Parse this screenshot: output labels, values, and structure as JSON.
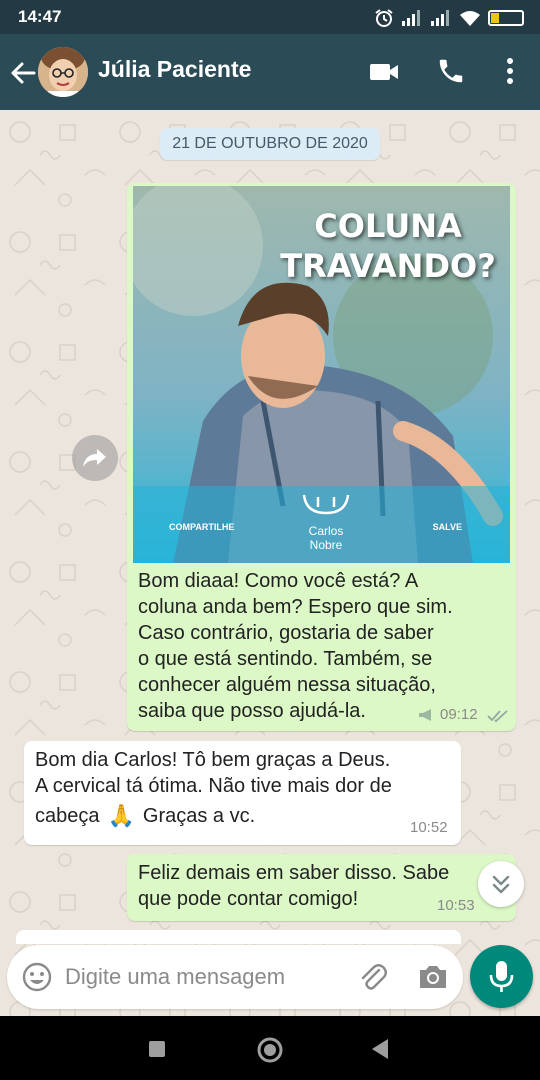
{
  "status_bar": {
    "time": "14:47",
    "battery": "24"
  },
  "header": {
    "contact_name": "Júlia Paciente"
  },
  "chat": {
    "date_chip": "21 DE OUTUBRO DE 2020",
    "image_message": {
      "image_title": "COLUNA\nTRAVANDO?",
      "image_share": "COMPARTILHE",
      "image_save": "SALVE",
      "image_logo": "Carlos Nobre",
      "caption": "Bom diaaa! Como você está? A\ncoluna anda bem? Espero que sim.\nCaso contrário, gostaria de saber\no que está sentindo. Também, se\nconhecer alguém nessa situação,\nsaiba que posso ajudá-la.",
      "time": "09:12"
    },
    "incoming_message": {
      "line1": "Bom dia Carlos! Tô bem graças a Deus.",
      "line2": "A cervical tá ótima. Não tive mais dor de",
      "line3_before": "cabeça",
      "emoji": "🙏",
      "line3_after": "Graças a vc.",
      "time": "10:52"
    },
    "outgoing_message": {
      "text": "Feliz demais em saber disso. Sabe\nque pode contar comigo!",
      "time": "10:53"
    }
  },
  "composer": {
    "placeholder": "Digite uma mensagem",
    "value": ""
  },
  "colors": {
    "header": "#2b4b57",
    "outgoing_bubble": "#dcf8c6",
    "incoming_bubble": "#ffffff",
    "accent": "#00897b",
    "chat_background": "#ece5dd"
  },
  "icons": [
    "back-arrow-icon",
    "video-call-icon",
    "phone-icon",
    "more-vert-icon",
    "forward-icon",
    "double-check-icon",
    "mic-icon",
    "emoji-icon",
    "attach-icon",
    "camera-icon",
    "chevron-down-icon",
    "nav-back-icon",
    "nav-home-icon",
    "nav-recents-icon"
  ]
}
